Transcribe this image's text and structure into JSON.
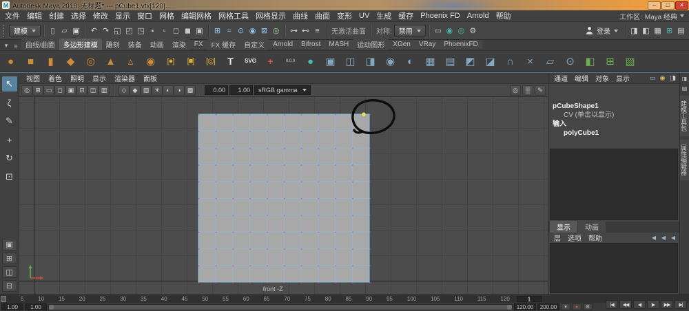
{
  "titlebar": {
    "app_icon_letter": "M",
    "title": "Autodesk Maya 2018: 无标题* --- pCube1.vtx[120]...",
    "minimize_glyph": "–",
    "maximize_glyph": "□",
    "close_glyph": "×"
  },
  "menubar": {
    "items": [
      "文件",
      "编辑",
      "创建",
      "选择",
      "修改",
      "显示",
      "窗口",
      "网格",
      "编辑网格",
      "网格工具",
      "网格显示",
      "曲线",
      "曲面",
      "变形",
      "UV",
      "生成",
      "缓存",
      "Phoenix FD",
      "Arnold",
      "帮助"
    ],
    "workspace_label": "工作区:",
    "workspace_value": "Maya 经典"
  },
  "statusline": {
    "menu_set": "建模",
    "file_icons": [
      {
        "name": "new-scene-icon",
        "glyph": "▯",
        "color": "#d2d2d2"
      },
      {
        "name": "open-scene-icon",
        "glyph": "▱",
        "color": "#d2d2d2"
      },
      {
        "name": "save-scene-icon",
        "glyph": "▣",
        "color": "#d2d2d2"
      }
    ],
    "undo_icons": [
      {
        "name": "undo-icon",
        "glyph": "↶",
        "color": "#cfcfcf"
      },
      {
        "name": "redo-icon",
        "glyph": "↷",
        "color": "#cfcfcf"
      }
    ],
    "select_mode_icons": [
      {
        "name": "select-hierarchy-icon",
        "glyph": "◱",
        "color": "#cfcfcf"
      },
      {
        "name": "select-object-icon",
        "glyph": "◰",
        "color": "#cfcfcf"
      },
      {
        "name": "select-component-icon",
        "glyph": "◳",
        "color": "#cfcfcf"
      }
    ],
    "mask_icons": [
      {
        "name": "mask-points-icon",
        "glyph": "▪",
        "color": "#c8c8c8"
      },
      {
        "name": "mask-lines-icon",
        "glyph": "▫",
        "color": "#c8c8c8"
      },
      {
        "name": "mask-faces-icon",
        "glyph": "◻",
        "color": "#c8c8c8"
      },
      {
        "name": "mask-hulls-icon",
        "glyph": "◼",
        "color": "#c8c8c8"
      },
      {
        "name": "mask-objects-icon",
        "glyph": "▣",
        "color": "#c8c8c8"
      }
    ],
    "snap_icons": [
      {
        "name": "snap-grid-icon",
        "glyph": "⊞",
        "color": "#8fc3ee"
      },
      {
        "name": "snap-curve-icon",
        "glyph": "≈",
        "color": "#8fc3ee"
      },
      {
        "name": "snap-point-icon",
        "glyph": "⊙",
        "color": "#8fc3ee"
      },
      {
        "name": "snap-projected-center-icon",
        "glyph": "◉",
        "color": "#8fc3ee"
      },
      {
        "name": "snap-view-plane-icon",
        "glyph": "⊠",
        "color": "#8fc3ee"
      },
      {
        "name": "make-live-icon",
        "glyph": "◎",
        "color": "#9fd89f"
      }
    ],
    "live_surface_label": "无激活曲面",
    "symmetry_label": "对称:",
    "symmetry_value": "禁用",
    "history_icons": [
      {
        "name": "input-connections-icon",
        "glyph": "⊶",
        "color": "#cfcfcf"
      },
      {
        "name": "output-connections-icon",
        "glyph": "⊷",
        "color": "#cfcfcf"
      },
      {
        "name": "construction-history-icon",
        "glyph": "≡",
        "color": "#cfcfcf"
      }
    ],
    "render_icons": [
      {
        "name": "open-render-view-icon",
        "glyph": "▭",
        "color": "#cfcfcf"
      },
      {
        "name": "render-current-frame-icon",
        "glyph": "◉",
        "color": "#49b8a8"
      },
      {
        "name": "ipr-render-icon",
        "glyph": "◎",
        "color": "#49b8a8"
      },
      {
        "name": "render-settings-icon",
        "glyph": "⚙",
        "color": "#cfcfcf"
      }
    ],
    "sign_in_label": "登录",
    "sidebar_toggle_icons": [
      {
        "name": "attribute-editor-toggle-icon",
        "glyph": "◨",
        "color": "#d2d2d2"
      },
      {
        "name": "tool-settings-toggle-icon",
        "glyph": "◧",
        "color": "#d2d2d2"
      },
      {
        "name": "channel-box-toggle-icon",
        "glyph": "▦",
        "color": "#d2d2d2"
      },
      {
        "name": "modeling-toolkit-toggle-icon",
        "glyph": "⊞",
        "color": "#49b8a8"
      },
      {
        "name": "outliner-toggle-icon",
        "glyph": "▤",
        "color": "#d2d2d2"
      }
    ]
  },
  "shelf": {
    "tab_tools": [
      {
        "name": "shelf-menu-icon",
        "glyph": "▾"
      },
      {
        "name": "shelf-config-icon",
        "glyph": "≡"
      }
    ],
    "tabs": [
      {
        "label": "曲线/曲面"
      },
      {
        "label": "多边形建模",
        "active": true
      },
      {
        "label": "雕刻"
      },
      {
        "label": "装备"
      },
      {
        "label": "动画"
      },
      {
        "label": "渲染"
      },
      {
        "label": "FX"
      },
      {
        "label": "FX 缓存"
      },
      {
        "label": "自定义"
      },
      {
        "label": "Arnold"
      },
      {
        "label": "Bifrost"
      },
      {
        "label": "MASH"
      },
      {
        "label": "运动图形"
      },
      {
        "label": "XGen"
      },
      {
        "label": "VRay"
      },
      {
        "label": "PhoenixFD"
      }
    ],
    "icons": [
      {
        "name": "poly-sphere",
        "glyph": "●",
        "color": "#cd8c3a"
      },
      {
        "name": "poly-cube",
        "glyph": "■",
        "color": "#cd8c3a"
      },
      {
        "name": "poly-cylinder",
        "glyph": "▮",
        "color": "#cd8c3a"
      },
      {
        "name": "poly-plane",
        "glyph": "◆",
        "color": "#cd8c3a"
      },
      {
        "name": "poly-torus",
        "glyph": "◎",
        "color": "#cd8c3a"
      },
      {
        "name": "poly-cone",
        "glyph": "▲",
        "color": "#cd8c3a"
      },
      {
        "name": "poly-pyramid",
        "glyph": "▵",
        "color": "#cd8c3a"
      },
      {
        "name": "poly-pipe",
        "glyph": "◉",
        "color": "#cd8c3a"
      },
      {
        "name": "interactive-sphere",
        "glyph": "[●]",
        "color": "#e0b23c"
      },
      {
        "name": "interactive-cube",
        "glyph": "[■]",
        "color": "#e0b23c"
      },
      {
        "name": "interactive-torus",
        "glyph": "[◎]",
        "color": "#e0b23c"
      },
      {
        "name": "type-tool",
        "glyph": "T",
        "color": "#ececec"
      },
      {
        "name": "svg-tool",
        "glyph": "SVG",
        "color": "#ececec"
      },
      {
        "name": "construction-axis",
        "glyph": "+",
        "color": "#cc5544"
      },
      {
        "name": "origin-locator",
        "glyph": "0,0,0",
        "color": "#cfcfcf"
      },
      {
        "name": "smooth-mesh-preview",
        "glyph": "●",
        "color": "#49b8a8"
      },
      {
        "name": "combine",
        "glyph": "▣",
        "color": "#85a8c2"
      },
      {
        "name": "separate",
        "glyph": "◫",
        "color": "#85a8c2"
      },
      {
        "name": "extract",
        "glyph": "◨",
        "color": "#85a8c2"
      },
      {
        "name": "boolean-union",
        "glyph": "◉",
        "color": "#85a8c2"
      },
      {
        "name": "boolean-difference",
        "glyph": "◐",
        "color": "#85a8c2"
      },
      {
        "name": "smooth",
        "glyph": "▦",
        "color": "#85a8c2"
      },
      {
        "name": "reduce",
        "glyph": "▤",
        "color": "#85a8c2"
      },
      {
        "name": "extrude",
        "glyph": "◩",
        "color": "#85a8c2"
      },
      {
        "name": "bevel",
        "glyph": "◪",
        "color": "#85a8c2"
      },
      {
        "name": "bridge",
        "glyph": "∩",
        "color": "#85a8c2"
      },
      {
        "name": "multi-cut",
        "glyph": "×",
        "color": "#85a8c2"
      },
      {
        "name": "quad-draw",
        "glyph": "▱",
        "color": "#85a8c2"
      },
      {
        "name": "target-weld",
        "glyph": "⊙",
        "color": "#85a8c2"
      },
      {
        "name": "mirror",
        "glyph": "◧",
        "color": "#6fae54"
      },
      {
        "name": "lattice",
        "glyph": "⊞",
        "color": "#6fae54"
      },
      {
        "name": "sculpt",
        "glyph": "▧",
        "color": "#6fae54"
      }
    ]
  },
  "toolbox": {
    "tools": [
      {
        "name": "select-tool",
        "glyph": "↖",
        "active": true
      },
      {
        "name": "lasso-select-tool",
        "glyph": "ζ"
      },
      {
        "name": "paint-select-tool",
        "glyph": "✎"
      },
      {
        "name": "move-tool",
        "glyph": "+"
      },
      {
        "name": "rotate-tool",
        "glyph": "↻"
      },
      {
        "name": "scale-tool",
        "glyph": "⊡"
      }
    ],
    "layout_buttons": [
      {
        "name": "layout-single-pane-button",
        "glyph": "▣"
      },
      {
        "name": "layout-four-pane-button",
        "glyph": "⊞"
      },
      {
        "name": "layout-persp-outliner-button",
        "glyph": "◫"
      },
      {
        "name": "layout-split-button",
        "glyph": "⊟"
      }
    ]
  },
  "viewport": {
    "menus": [
      "视图",
      "着色",
      "照明",
      "显示",
      "渲染器",
      "面板"
    ],
    "toolbar_icons_a": [
      {
        "name": "camera-pivot-icon",
        "glyph": "◎"
      },
      {
        "name": "grid-toggle-icon",
        "glyph": "⊞"
      },
      {
        "name": "film-gate-icon",
        "glyph": "▭"
      },
      {
        "name": "resolution-gate-icon",
        "glyph": "◻"
      },
      {
        "name": "gate-mask-icon",
        "glyph": "▣"
      },
      {
        "name": "field-chart-icon",
        "glyph": "⊡"
      },
      {
        "name": "safe-action-icon",
        "glyph": "◫"
      },
      {
        "name": "safe-title-icon",
        "glyph": "▥"
      }
    ],
    "toolbar_icons_b": [
      {
        "name": "wireframe-mode-icon",
        "glyph": "◇"
      },
      {
        "name": "shaded-mode-icon",
        "glyph": "◆"
      },
      {
        "name": "textured-mode-icon",
        "glyph": "▨"
      },
      {
        "name": "use-all-lights-icon",
        "glyph": "☀"
      },
      {
        "name": "shadows-icon",
        "glyph": "◐"
      },
      {
        "name": "ambient-occlusion-icon",
        "glyph": "◑"
      },
      {
        "name": "anti-aliasing-icon",
        "glyph": "▩"
      }
    ],
    "exposure_value": "0.00",
    "gamma_value": "1.00",
    "view_transform": "sRGB gamma",
    "toolbar_icons_c": [
      {
        "name": "isolate-select-icon",
        "glyph": "◎"
      },
      {
        "name": "xray-icon",
        "glyph": "▒"
      },
      {
        "name": "grease-pencil-icon",
        "glyph": "✎"
      }
    ],
    "camera_label": "front -Z"
  },
  "channel_box": {
    "menus": [
      "通道",
      "编辑",
      "对象",
      "显示"
    ],
    "mini_icons": [
      {
        "name": "channel-slider-mode-icon",
        "glyph": "▭",
        "color": "#8fc3ee"
      },
      {
        "name": "channel-speed-icon",
        "glyph": "◉",
        "color": "#d8c05a"
      },
      {
        "name": "channel-manip-icon",
        "glyph": "◨",
        "color": "#cfcfcf"
      }
    ],
    "shape_node": "pCubeShape1",
    "component_row": "CV (单击以显示)",
    "inputs_header": "输入",
    "input_node": "polyCube1"
  },
  "layer_editor": {
    "tabs": [
      {
        "label": "显示",
        "active": true
      },
      {
        "label": "动画"
      }
    ],
    "menus": [
      "层",
      "选项",
      "帮助"
    ],
    "layer_buttons": [
      {
        "name": "new-empty-layer-icon",
        "glyph": "◀"
      },
      {
        "name": "new-layer-from-selected-icon",
        "glyph": "◀"
      },
      {
        "name": "move-layer-icon",
        "glyph": "◀"
      }
    ]
  },
  "right_strip": {
    "icons": [
      {
        "name": "dock-right-icon",
        "glyph": "◨"
      },
      {
        "name": "expand-panel-icon",
        "glyph": "▤"
      }
    ],
    "tabs": [
      "建模工具包",
      "属性编辑器"
    ]
  },
  "timeline": {
    "ticks": [
      "5",
      "10",
      "15",
      "20",
      "25",
      "30",
      "35",
      "40",
      "45",
      "50",
      "55",
      "60",
      "65",
      "70",
      "75",
      "80",
      "85",
      "90",
      "95",
      "100",
      "105",
      "110",
      "115",
      "120"
    ],
    "current_frame": "1",
    "transport": [
      {
        "name": "go-to-start-button",
        "glyph": "|◀"
      },
      {
        "name": "step-back-frame-button",
        "glyph": "◀◀"
      },
      {
        "name": "play-backward-button",
        "glyph": "◀"
      },
      {
        "name": "play-forward-button",
        "glyph": "▶"
      },
      {
        "name": "step-forward-frame-button",
        "glyph": "▶▶"
      },
      {
        "name": "go-to-end-button",
        "glyph": "▶|"
      }
    ]
  },
  "range_slider": {
    "anim_start": "1.00",
    "playback_start": "1.00",
    "playback_end": "120.00",
    "anim_end": "200.00",
    "buttons": [
      {
        "name": "character-set-menu-button",
        "glyph": "▾",
        "color": "#cccccc"
      },
      {
        "name": "auto-keyframe-button",
        "glyph": "●",
        "color": "#cc5544"
      },
      {
        "name": "animation-preferences-button",
        "glyph": "⚙",
        "color": "#cccccc"
      }
    ]
  }
}
